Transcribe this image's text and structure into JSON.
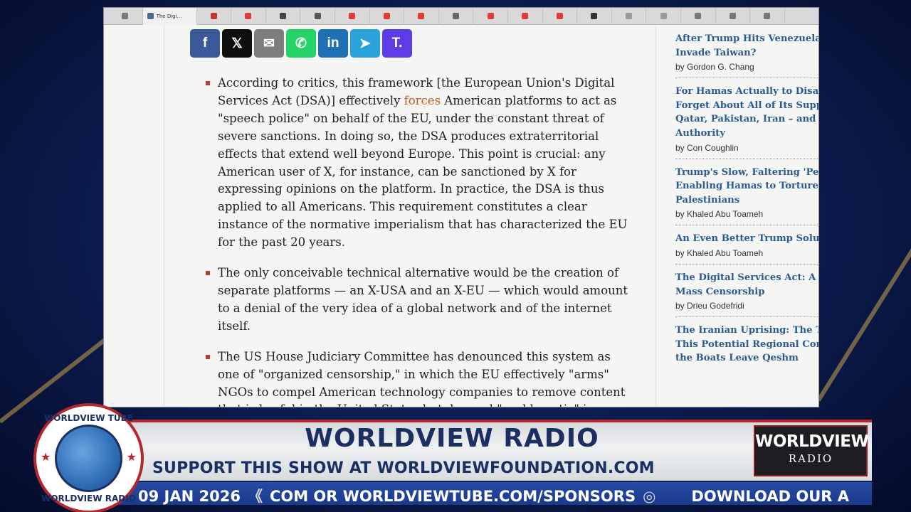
{
  "browser": {
    "active_tab_label": "The Digi...",
    "tabs": [
      "",
      "",
      "",
      "",
      "",
      "",
      "",
      "",
      "",
      "",
      "",
      "",
      "",
      "",
      "",
      "",
      "",
      "",
      "",
      ""
    ]
  },
  "share_buttons": [
    {
      "label": "f",
      "icon": "facebook-icon",
      "color": "#3b5998"
    },
    {
      "label": "𝕏",
      "icon": "x-icon",
      "color": "#0f0f0f"
    },
    {
      "label": "✉",
      "icon": "email-icon",
      "color": "#7d7d7d"
    },
    {
      "label": "✆",
      "icon": "whatsapp-icon",
      "color": "#25d366"
    },
    {
      "label": "in",
      "icon": "linkedin-icon",
      "color": "#1f70b5"
    },
    {
      "label": "➤",
      "icon": "telegram-icon",
      "color": "#2aa3db"
    },
    {
      "label": "T.",
      "icon": "gettr-icon",
      "color": "#5c3ce6"
    }
  ],
  "article": {
    "bullet1_pre": "According to critics, this framework [the European Union's Digital Services Act (DSA)] effectively ",
    "bullet1_link": "forces",
    "bullet1_post": " American platforms to act as \"speech police\" on behalf of the EU, under the constant threat of severe sanctions. In doing so, the DSA produces extraterritorial effects that extend well beyond Europe. This point is crucial: any American user of X, for instance, can be sanctioned by X for expressing opinions on the platform. In practice, the DSA is thus applied to all Americans. This requirement constitutes a clear instance of the normative imperialism that has characterized the EU for the past 20 years.",
    "bullet2": "The only conceivable technical alternative would be the creation of separate platforms — an X-USA and an X-EU — which would amount to a denial of the very idea of a global network and of the internet itself.",
    "bullet3": "The US House Judiciary Committee has denounced this system as one of \"organized censorship,\" in which the EU effectively \"arms\" NGOs to compel American technology companies to remove content that is lawful in the United States but deemed \"problematic\" in Europe."
  },
  "sidebar": {
    "items": [
      {
        "title_lines": [
          "After Trump Hits Venezuela,",
          "Invade Taiwan?"
        ],
        "author": "by Gordon G. Chang"
      },
      {
        "title_lines": [
          "For Hamas Actually to Disarm",
          "Forget About All of Its Suppor",
          "Qatar, Pakistan, Iran – and th",
          "Authority"
        ],
        "author": "by Con Coughlin"
      },
      {
        "title_lines": [
          "Trump's Slow, Faltering 'Peac",
          "Enabling Hamas to Torture a",
          "Palestinians"
        ],
        "author": "by Khaled Abu Toameh"
      },
      {
        "title_lines": [
          "An Even Better Trump Solutio"
        ],
        "author": "by Khaled Abu Toameh"
      },
      {
        "title_lines": [
          "The Digital Services Act: A Me",
          "Mass Censorship"
        ],
        "author": "by Drieu Godefridi"
      },
      {
        "title_lines": [
          "The Iranian Uprising: The Tim",
          "This Potential Regional Confl",
          "the Boats Leave Qeshm"
        ],
        "author": ""
      }
    ]
  },
  "overlay": {
    "title": "WORLDVIEW RADIO",
    "support": "SUPPORT THIS SHOW AT WORLDVIEWFOUNDATION.COM",
    "ticker_date": "09 JAN 2026",
    "ticker_sep": "《",
    "ticker_text": "COM OR WORLDVIEWTUBE.COM/SPONSORS",
    "ticker_icon": "◎",
    "ticker_download": "DOWNLOAD OUR A",
    "logo_main": "WORLDVIEW",
    "logo_sub": "RADIO",
    "seal_top": "WORLDVIEW TUBE",
    "seal_bottom": "WORLDVIEW RADIO"
  }
}
